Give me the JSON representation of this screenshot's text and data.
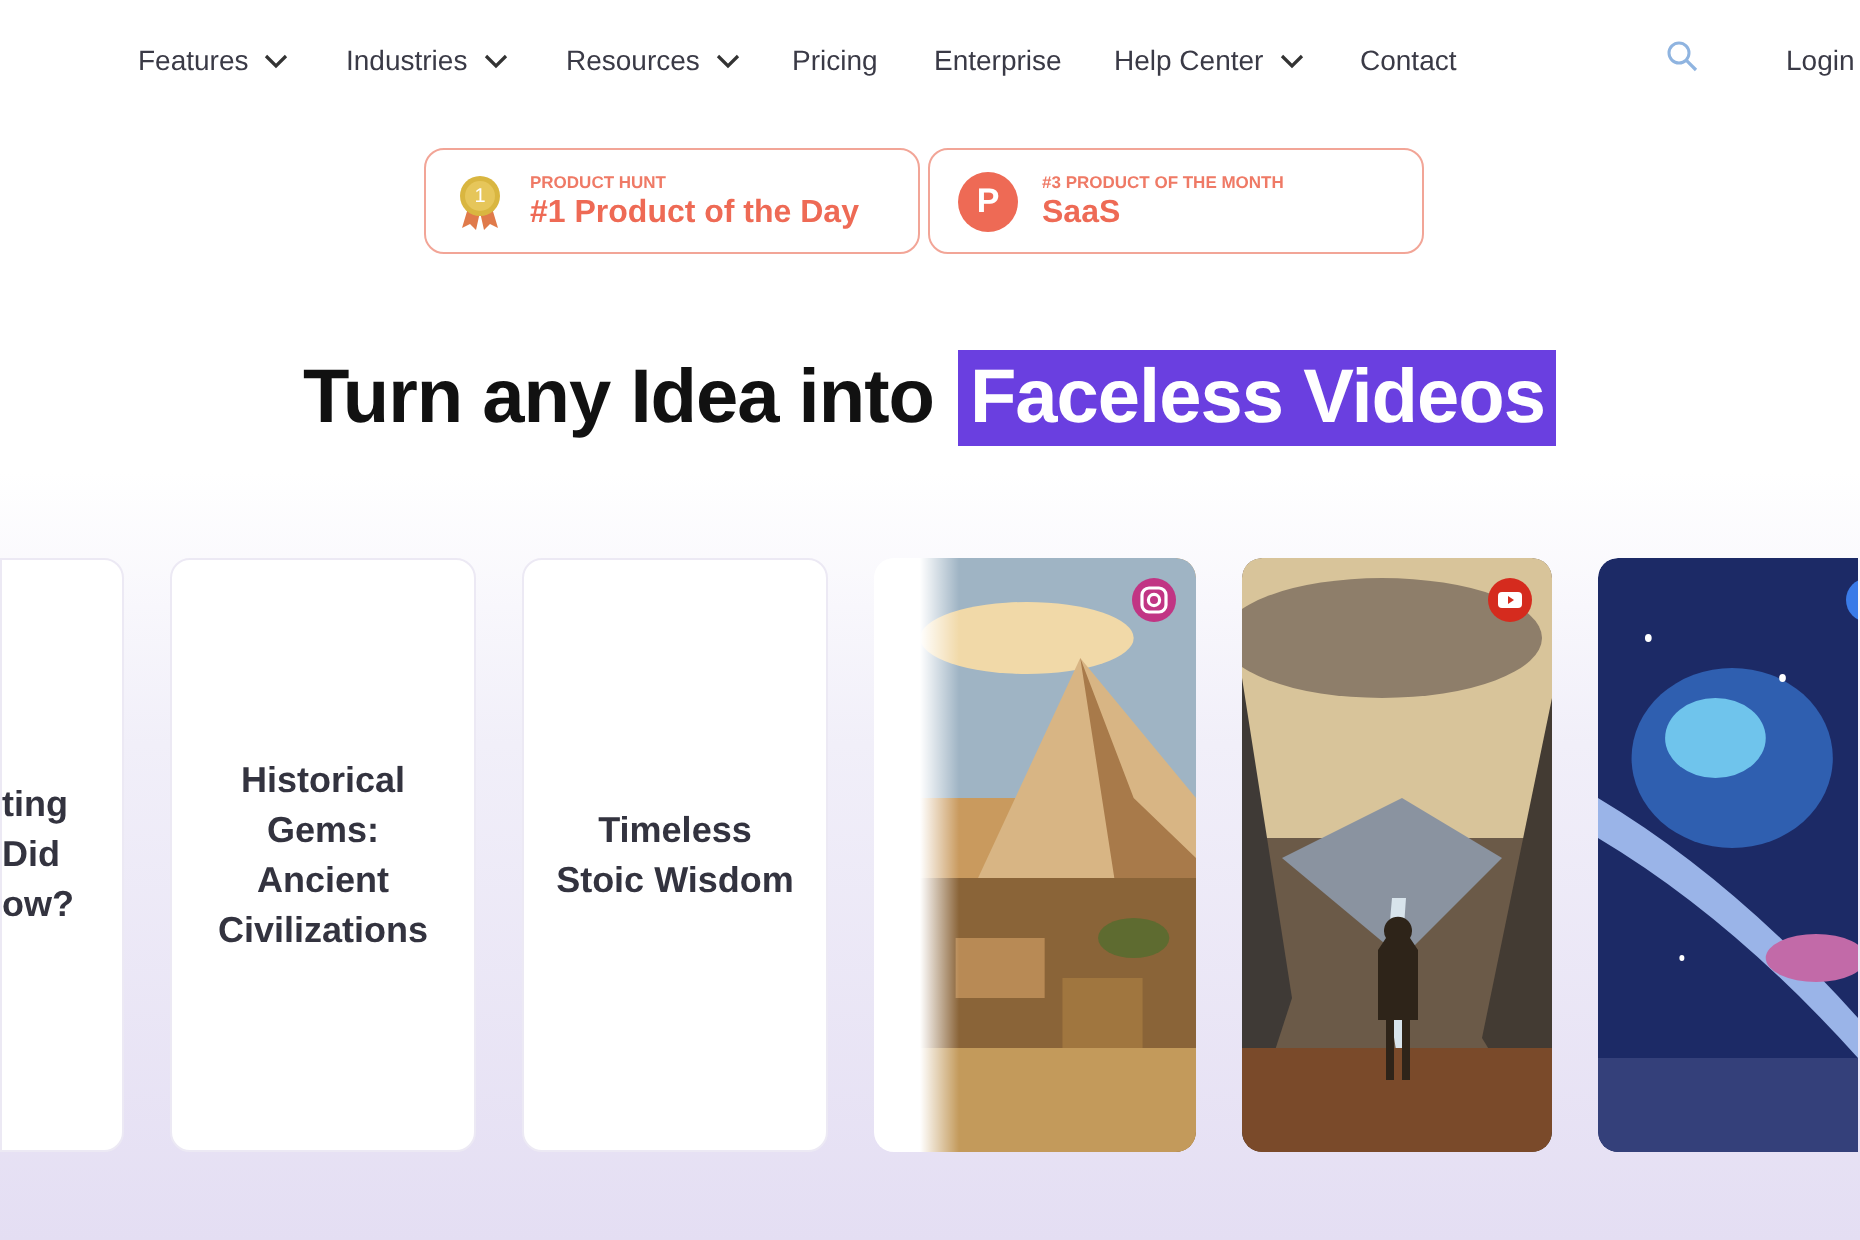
{
  "nav": {
    "items": [
      {
        "label": "Features",
        "dropdown": true
      },
      {
        "label": "Industries",
        "dropdown": true
      },
      {
        "label": "Resources",
        "dropdown": true
      },
      {
        "label": "Pricing",
        "dropdown": false
      },
      {
        "label": "Enterprise",
        "dropdown": false
      },
      {
        "label": "Help Center",
        "dropdown": true
      },
      {
        "label": "Contact",
        "dropdown": false
      }
    ],
    "login": "Login"
  },
  "awards": [
    {
      "kind": "medal",
      "medal_number": "1",
      "eyebrow": "PRODUCT HUNT",
      "title": "#1 Product of the Day"
    },
    {
      "kind": "logo",
      "logo_letter": "P",
      "eyebrow": "#3 PRODUCT OF THE MONTH",
      "title": "SaaS"
    }
  ],
  "headline": {
    "text": "Turn any Idea into",
    "highlight": "Faceless Videos"
  },
  "cards": [
    {
      "kind": "topic",
      "lines": [
        "ting",
        "Did",
        "ow?"
      ]
    },
    {
      "kind": "topic",
      "lines": [
        "Historical",
        "Gems:",
        "Ancient",
        "Civilizations"
      ]
    },
    {
      "kind": "topic",
      "lines": [
        "Timeless",
        "Stoic Wisdom"
      ]
    },
    {
      "kind": "video",
      "sliding": true
    },
    {
      "kind": "video",
      "sliding": false
    },
    {
      "kind": "video",
      "sliding": false
    }
  ]
}
